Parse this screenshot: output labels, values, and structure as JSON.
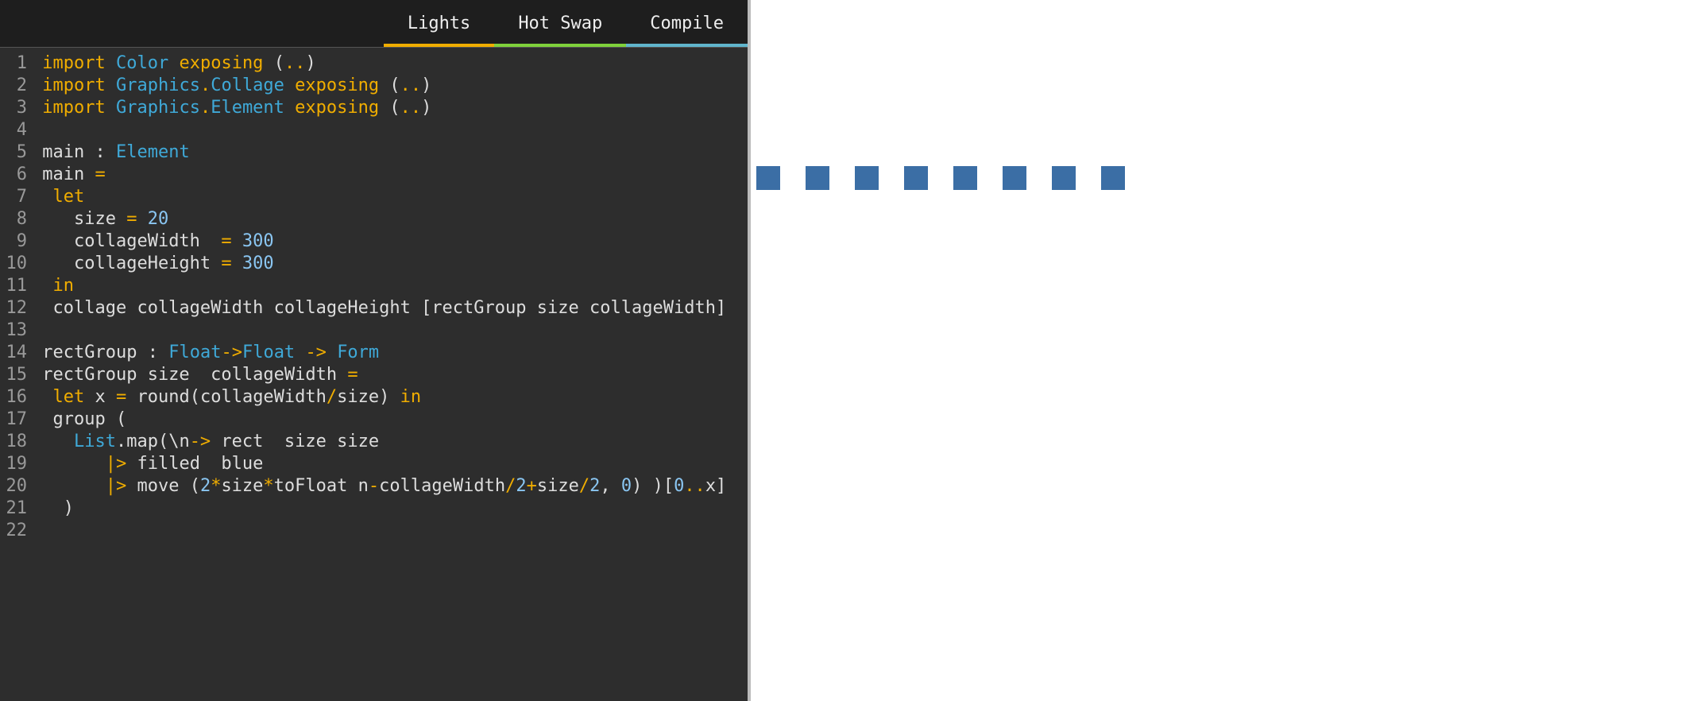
{
  "toolbar": {
    "lights": "Lights",
    "hotswap": "Hot Swap",
    "compile": "Compile"
  },
  "lines": {
    "n1": "1",
    "n2": "2",
    "n3": "3",
    "n4": "4",
    "n5": "5",
    "n6": "6",
    "n7": "7",
    "n8": "8",
    "n9": "9",
    "n10": "10",
    "n11": "11",
    "n12": "12",
    "n13": "13",
    "n14": "14",
    "n15": "15",
    "n16": "16",
    "n17": "17",
    "n18": "18",
    "n19": "19",
    "n20": "20",
    "n21": "21",
    "n22": "22"
  },
  "code": {
    "import_kw": "import",
    "color_mod": "Color",
    "exposing_kw": "exposing",
    "lparen": "(",
    "rparen": ")",
    "dotdot": "..",
    "graphics": "Graphics",
    "dot": ".",
    "collage_mod": "Collage",
    "element_mod": "Element",
    "main": "main",
    "colon": " : ",
    "element_type": "Element",
    "eq": " =",
    "let_kw": "let",
    "size_var": "size",
    "eq2": " = ",
    "twenty": "20",
    "collageWidth": "collageWidth",
    "eq3": "  = ",
    "three_hundred": "300",
    "collageHeight": "collageHeight",
    "eq4": " = ",
    "in_kw": "in",
    "line12": "  collage collageWidth collageHeight [rectGroup size collageWidth]",
    "rectGroup": "rectGroup",
    "float_type": "Float",
    "arrow": "->",
    "form_type": "Form",
    "line15_a": " rectGroup size  collageWidth ",
    "line15_eq": "=",
    "line16_let": "let",
    "line16_body": " x ",
    "line16_eq": "=",
    "line16_round": " round(collageWidth",
    "line16_slash": "/",
    "line16_size": "size) ",
    "line16_in": "in",
    "line17": "group (",
    "line18_list": "List",
    "line18_map": ".map(\\n",
    "line18_arrow": "->",
    "line18_rect": " rect  size size",
    "line19_pipe": "|>",
    "line19_filled": " filled  blue",
    "line20_pipe": "|>",
    "line20_move": " move (",
    "line20_two": "2",
    "line20_star": "*",
    "line20_sizetf": "size",
    "line20_star2": "*",
    "line20_tf": "toFloat n",
    "line20_minus": "-",
    "line20_cw": "collageWidth",
    "line20_slash": "/",
    "line20_two2": "2",
    "line20_plus": "+",
    "line20_size": "size",
    "line20_slash2": "/",
    "line20_two3": "2",
    "line20_comma": ", ",
    "line20_zero": "0",
    "line20_rp": ") )[",
    "line20_zero2": "0",
    "line20_ddot": "..",
    "line20_x": "x]",
    "line21": "   )"
  },
  "output": {
    "square_count": 8,
    "square_color": "#3b6ea5"
  }
}
